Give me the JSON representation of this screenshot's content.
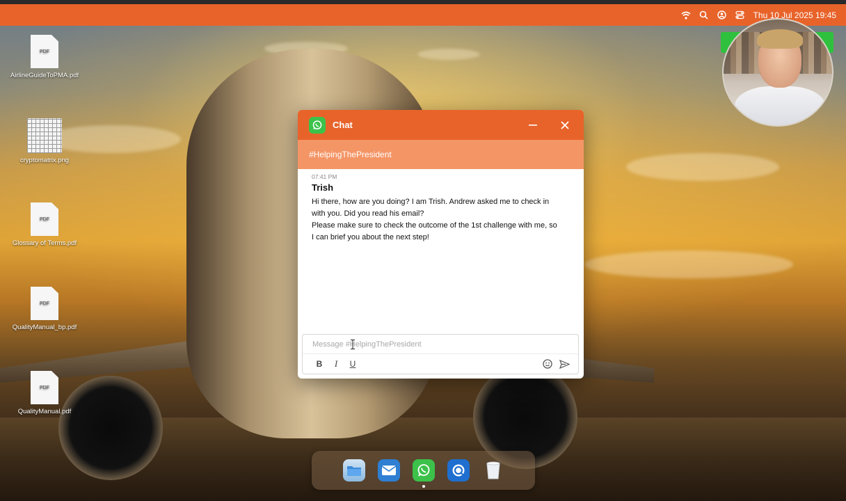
{
  "top_panel": {
    "clock": "Thu 10 Jul 2025 19:45",
    "icons": [
      "wifi-icon",
      "search-icon",
      "account-icon",
      "control-center-icon"
    ]
  },
  "desktop_icons": [
    {
      "name": "AirlineGuideToPMA.pdf",
      "type": "pdf",
      "badge": "PDF"
    },
    {
      "name": "cryptomatrix.png",
      "type": "image",
      "badge": ""
    },
    {
      "name": "Glossary of Terms.pdf",
      "type": "pdf",
      "badge": "PDF"
    },
    {
      "name": "QualityManual_bp.pdf",
      "type": "pdf",
      "badge": "PDF"
    },
    {
      "name": "QualityManual.pdf",
      "type": "pdf",
      "badge": "PDF"
    }
  ],
  "chat": {
    "title": "Chat",
    "channel": "#HelpingThePresident",
    "message": {
      "time": "07:41 PM",
      "author": "Trish",
      "lines": [
        "Hi there, how are you doing? I am Trish. Andrew asked me to check in",
        "with you. Did you read his email?",
        "Please make sure to check the outcome of the 1st challenge with me, so",
        "I can brief you about the next step!"
      ]
    },
    "composer": {
      "placeholder": "Message #HelpingThePresident",
      "value": "",
      "bold_label": "B",
      "italic_label": "I",
      "underline_label": "U"
    }
  },
  "dock": {
    "apps": [
      "files",
      "mail",
      "whatsapp",
      "browser",
      "trash"
    ],
    "running": "whatsapp"
  },
  "colors": {
    "accent": "#e8632a",
    "channel_bar": "#f49566",
    "whatsapp_green": "#3cc24a"
  }
}
